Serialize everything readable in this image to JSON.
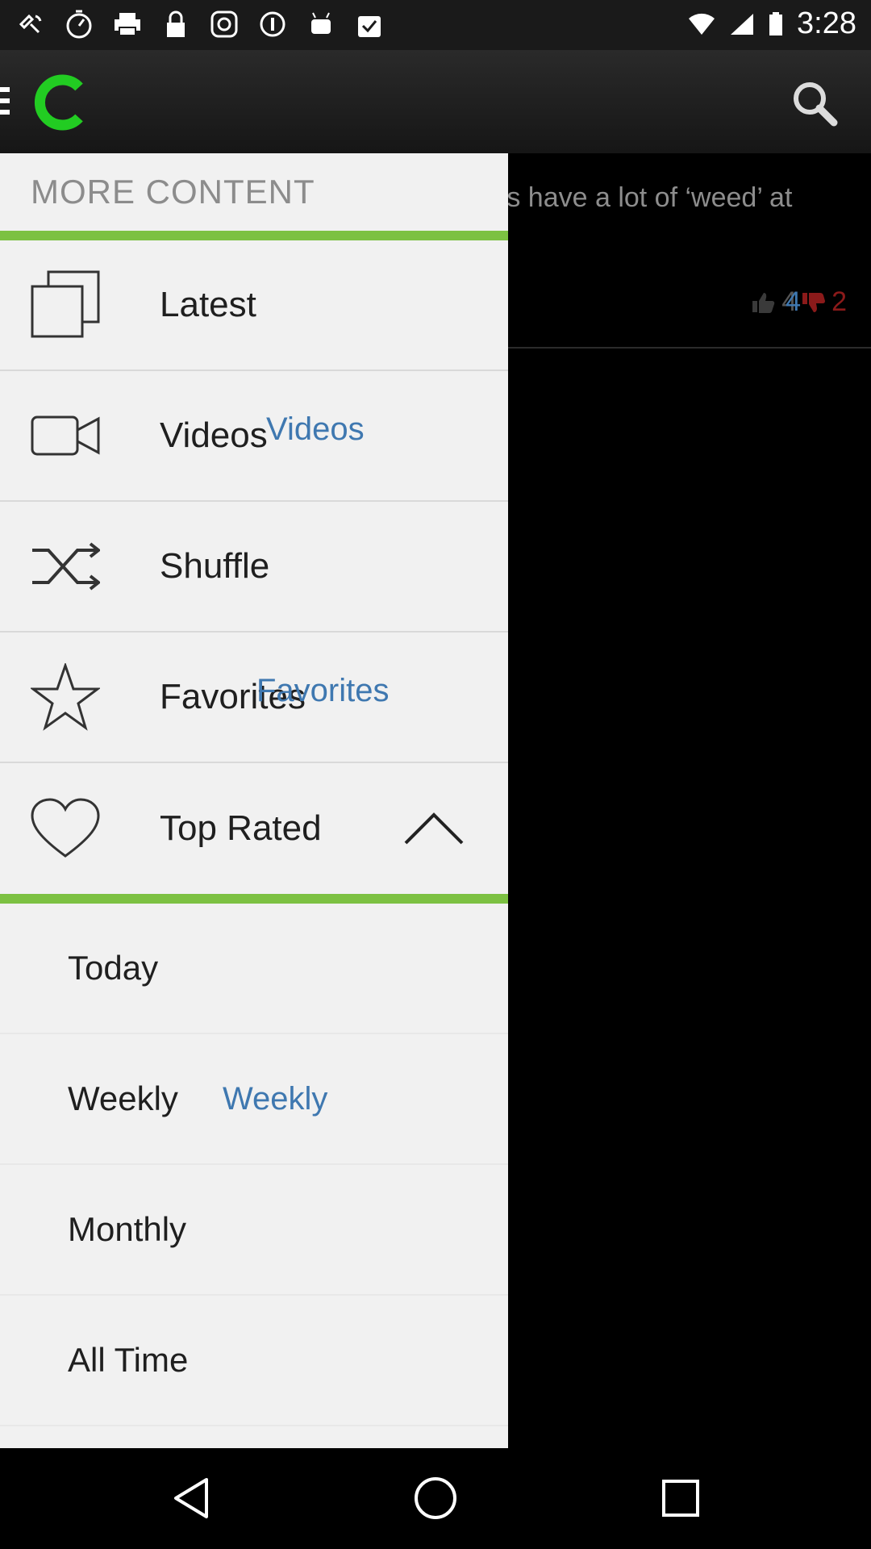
{
  "status_bar": {
    "time": "3:28",
    "icons": [
      "location-off-icon",
      "timer-icon",
      "print-icon",
      "lock-icon",
      "instagram-icon",
      "info-icon",
      "android-icon",
      "check-bag-icon"
    ]
  },
  "app_bar": {
    "logo_letter": "C",
    "brand_color": "#22cc22"
  },
  "background_post": {
    "snippet": "nts have a lot of ‘weed’ at",
    "likes": "4",
    "likes_overlay": "4",
    "dislikes": "2"
  },
  "drawer": {
    "header": "MORE CONTENT",
    "accent_color": "#7cc142",
    "items": [
      {
        "label": "Latest",
        "hint": "",
        "icon": "copy-icon"
      },
      {
        "label": "Videos",
        "hint": "Videos",
        "icon": "video-camera-icon"
      },
      {
        "label": "Shuffle",
        "hint": "",
        "icon": "shuffle-icon"
      },
      {
        "label": "Favorites",
        "hint": "Favorites",
        "icon": "star-icon"
      },
      {
        "label": "Top Rated",
        "hint": "",
        "icon": "heart-icon"
      }
    ],
    "sub_items": [
      {
        "label": "Today",
        "hint": ""
      },
      {
        "label": "Weekly",
        "hint": "Weekly"
      },
      {
        "label": "Monthly",
        "hint": ""
      },
      {
        "label": "All Time",
        "hint": ""
      }
    ]
  },
  "nav_bar": {
    "back": "back-icon",
    "home": "home-icon",
    "recents": "recents-icon"
  }
}
